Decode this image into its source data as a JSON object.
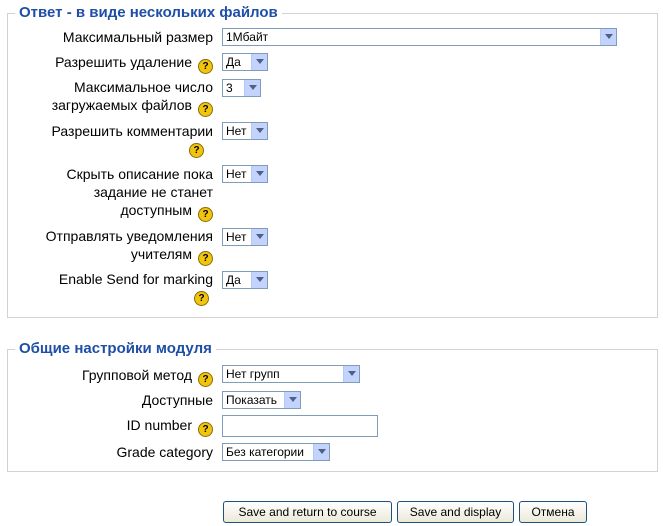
{
  "section1": {
    "title": "Ответ - в виде нескольких файлов",
    "fields": [
      {
        "label": "Максимальный размер",
        "value": "1Мбайт",
        "help": false
      },
      {
        "label": "Разрешить удаление",
        "value": "Да",
        "help": true
      },
      {
        "label_lines": [
          "Максимальное число",
          "загружаемых файлов"
        ],
        "value": "3",
        "help": true
      },
      {
        "label": "Разрешить комментарии",
        "value": "Нет",
        "help": true
      },
      {
        "label_lines": [
          "Скрыть описание пока",
          "задание не станет",
          "доступным"
        ],
        "value": "Нет",
        "help": true
      },
      {
        "label_lines": [
          "Отправлять уведомления",
          "учителям"
        ],
        "value": "Нет",
        "help": true
      },
      {
        "label": "Enable Send for marking",
        "value": "Да",
        "help": true
      }
    ]
  },
  "section2": {
    "title": "Общие настройки модуля",
    "fields": [
      {
        "label": "Групповой метод",
        "value": "Нет групп",
        "help": true
      },
      {
        "label": "Доступные",
        "value": "Показать",
        "help": false
      },
      {
        "label": "ID number",
        "value": "",
        "help": true
      },
      {
        "label": "Grade category",
        "value": "Без категории",
        "help": false
      }
    ]
  },
  "help_glyph": "?",
  "buttons": {
    "save_return": "Save and return to course",
    "save_display": "Save and display",
    "cancel": "Отмена"
  },
  "colors": {
    "legend": "#1e4ea8",
    "help_icon": "#f1c40f",
    "border": "#d2d2d2"
  }
}
